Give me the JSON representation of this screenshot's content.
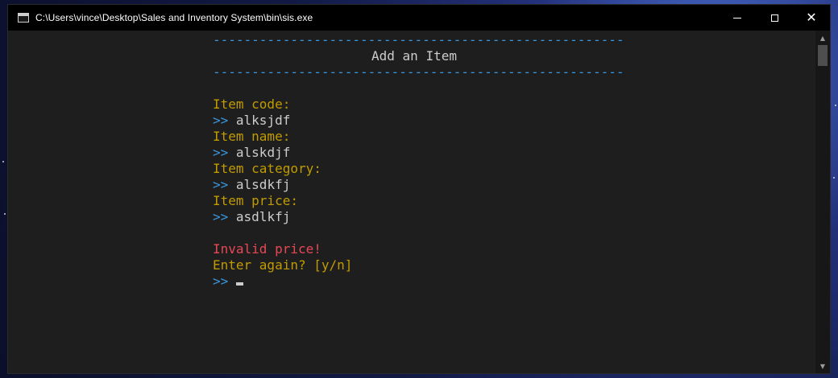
{
  "window": {
    "title": "C:\\Users\\vince\\Desktop\\Sales and Inventory System\\bin\\sis.exe",
    "close_symbol": "✕"
  },
  "console": {
    "rule": "-----------------------------------------------------",
    "header": "Add an Item",
    "prompt_symbol": ">>",
    "fields": [
      {
        "label": "Item code:",
        "value": "alksjdf"
      },
      {
        "label": "Item name:",
        "value": "alskdjf"
      },
      {
        "label": "Item category:",
        "value": "alsdkfj"
      },
      {
        "label": "Item price:",
        "value": "asdlkfj"
      }
    ],
    "error_message": "Invalid price!",
    "retry_prompt": "Enter again? [y/n]"
  },
  "colors": {
    "accent": "#3a96dd",
    "label": "#c19c00",
    "error": "#e74856",
    "text": "#cccccc"
  },
  "icons": [
    "console-app-icon",
    "minimize-icon",
    "maximize-icon",
    "close-icon",
    "scroll-up-icon",
    "scroll-down-icon"
  ]
}
